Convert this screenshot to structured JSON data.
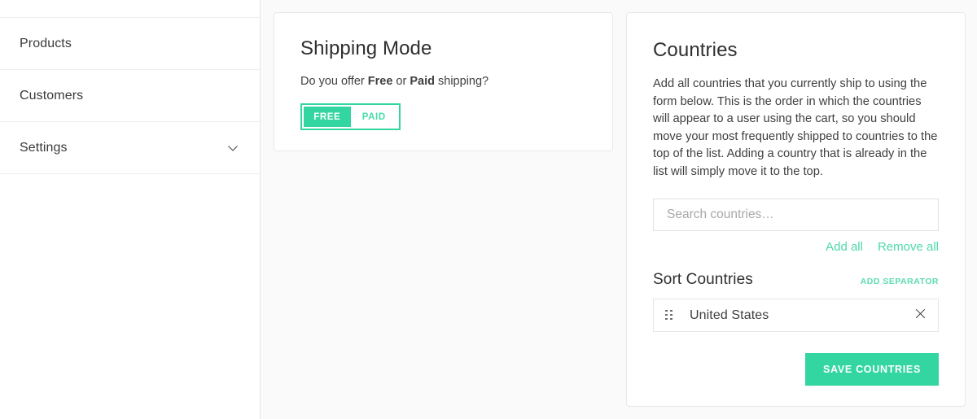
{
  "sidebar": {
    "items": [
      {
        "label": "Products",
        "icon": null
      },
      {
        "label": "Customers",
        "icon": null
      },
      {
        "label": "Settings",
        "icon": "chevron-down-icon"
      }
    ]
  },
  "shipping_card": {
    "title": "Shipping Mode",
    "question_prefix": "Do you offer ",
    "question_bold_1": "Free",
    "question_middle": " or ",
    "question_bold_2": "Paid",
    "question_suffix": " shipping?",
    "toggle": {
      "free_label": "FREE",
      "paid_label": "PAID",
      "selected": "FREE"
    }
  },
  "countries_card": {
    "title": "Countries",
    "description": "Add all countries that you currently ship to using the form below. This is the order in which the countries will appear to a user using the cart, so you should move your most frequently shipped to countries to the top of the list. Adding a country that is already in the list will simply move it to the top.",
    "search": {
      "placeholder": "Search countries…",
      "value": ""
    },
    "actions": {
      "add_all": "Add all",
      "remove_all": "Remove all"
    },
    "sort": {
      "title": "Sort Countries",
      "add_separator": "ADD SEPARATOR",
      "rows": [
        {
          "name": "United States",
          "drag_icon": "drag-handle-icon",
          "remove_icon": "close-icon"
        }
      ]
    },
    "save_label": "SAVE COUNTRIES"
  },
  "colors": {
    "accent_green": "#33d6a0",
    "accent_green_light": "#4fd9a8",
    "page_bg": "#fafafa",
    "card_bg": "#ffffff",
    "border": "#e8e8e8",
    "text": "#3f3f3f"
  }
}
